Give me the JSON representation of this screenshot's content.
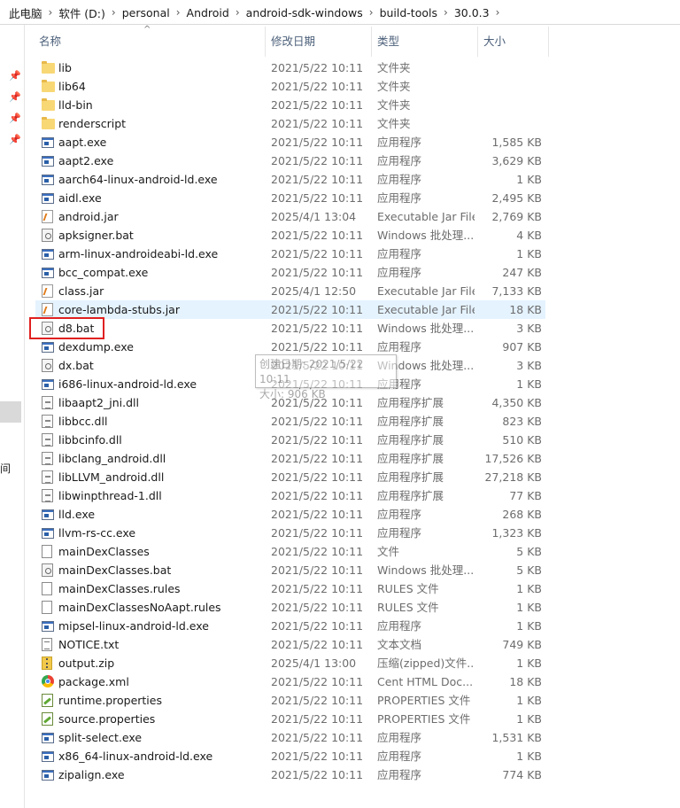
{
  "breadcrumb": [
    "此电脑",
    "软件 (D:)",
    "personal",
    "Android",
    "android-sdk-windows",
    "build-tools",
    "30.0.3"
  ],
  "left_nav": {
    "partial_label": "间"
  },
  "columns": {
    "name": "名称",
    "date": "修改日期",
    "type": "类型",
    "size": "大小"
  },
  "sort_indicator": "^",
  "tooltip": {
    "created": "创建日期: 2021/5/22 10:11",
    "size": "大小: 906 KB"
  },
  "files": [
    {
      "name": "lib",
      "date": "2021/5/22 10:11",
      "type": "文件夹",
      "size": "",
      "icon": "folder-icon"
    },
    {
      "name": "lib64",
      "date": "2021/5/22 10:11",
      "type": "文件夹",
      "size": "",
      "icon": "folder-icon"
    },
    {
      "name": "lld-bin",
      "date": "2021/5/22 10:11",
      "type": "文件夹",
      "size": "",
      "icon": "folder-icon"
    },
    {
      "name": "renderscript",
      "date": "2021/5/22 10:11",
      "type": "文件夹",
      "size": "",
      "icon": "folder-icon"
    },
    {
      "name": "aapt.exe",
      "date": "2021/5/22 10:11",
      "type": "应用程序",
      "size": "1,585 KB",
      "icon": "exe-icon"
    },
    {
      "name": "aapt2.exe",
      "date": "2021/5/22 10:11",
      "type": "应用程序",
      "size": "3,629 KB",
      "icon": "exe-icon"
    },
    {
      "name": "aarch64-linux-android-ld.exe",
      "date": "2021/5/22 10:11",
      "type": "应用程序",
      "size": "1 KB",
      "icon": "exe-icon"
    },
    {
      "name": "aidl.exe",
      "date": "2021/5/22 10:11",
      "type": "应用程序",
      "size": "2,495 KB",
      "icon": "exe-icon"
    },
    {
      "name": "android.jar",
      "date": "2025/4/1 13:04",
      "type": "Executable Jar File",
      "size": "2,769 KB",
      "icon": "jar-icon"
    },
    {
      "name": "apksigner.bat",
      "date": "2021/5/22 10:11",
      "type": "Windows 批处理...",
      "size": "4 KB",
      "icon": "bat-icon"
    },
    {
      "name": "arm-linux-androideabi-ld.exe",
      "date": "2021/5/22 10:11",
      "type": "应用程序",
      "size": "1 KB",
      "icon": "exe-icon"
    },
    {
      "name": "bcc_compat.exe",
      "date": "2021/5/22 10:11",
      "type": "应用程序",
      "size": "247 KB",
      "icon": "exe-icon"
    },
    {
      "name": "class.jar",
      "date": "2025/4/1 12:50",
      "type": "Executable Jar File",
      "size": "7,133 KB",
      "icon": "jar-icon"
    },
    {
      "name": "core-lambda-stubs.jar",
      "date": "2021/5/22 10:11",
      "type": "Executable Jar File",
      "size": "18 KB",
      "icon": "jar-icon",
      "hover": true
    },
    {
      "name": "d8.bat",
      "date": "2021/5/22 10:11",
      "type": "Windows 批处理...",
      "size": "3 KB",
      "icon": "bat-icon"
    },
    {
      "name": "dexdump.exe",
      "date": "2021/5/22 10:11",
      "type": "应用程序",
      "size": "907 KB",
      "icon": "exe-icon"
    },
    {
      "name": "dx.bat",
      "date": "2021/5/22 10:11",
      "type": "Windows 批处理...",
      "size": "3 KB",
      "icon": "bat-icon"
    },
    {
      "name": "i686-linux-android-ld.exe",
      "date": "2021/5/22 10:11",
      "type": "应用程序",
      "size": "1 KB",
      "icon": "exe-icon"
    },
    {
      "name": "libaapt2_jni.dll",
      "date": "2021/5/22 10:11",
      "type": "应用程序扩展",
      "size": "4,350 KB",
      "icon": "dll-icon"
    },
    {
      "name": "libbcc.dll",
      "date": "2021/5/22 10:11",
      "type": "应用程序扩展",
      "size": "823 KB",
      "icon": "dll-icon"
    },
    {
      "name": "libbcinfo.dll",
      "date": "2021/5/22 10:11",
      "type": "应用程序扩展",
      "size": "510 KB",
      "icon": "dll-icon"
    },
    {
      "name": "libclang_android.dll",
      "date": "2021/5/22 10:11",
      "type": "应用程序扩展",
      "size": "17,526 KB",
      "icon": "dll-icon"
    },
    {
      "name": "libLLVM_android.dll",
      "date": "2021/5/22 10:11",
      "type": "应用程序扩展",
      "size": "27,218 KB",
      "icon": "dll-icon"
    },
    {
      "name": "libwinpthread-1.dll",
      "date": "2021/5/22 10:11",
      "type": "应用程序扩展",
      "size": "77 KB",
      "icon": "dll-icon"
    },
    {
      "name": "lld.exe",
      "date": "2021/5/22 10:11",
      "type": "应用程序",
      "size": "268 KB",
      "icon": "exe-icon"
    },
    {
      "name": "llvm-rs-cc.exe",
      "date": "2021/5/22 10:11",
      "type": "应用程序",
      "size": "1,323 KB",
      "icon": "exe-icon"
    },
    {
      "name": "mainDexClasses",
      "date": "2021/5/22 10:11",
      "type": "文件",
      "size": "5 KB",
      "icon": "file-icon"
    },
    {
      "name": "mainDexClasses.bat",
      "date": "2021/5/22 10:11",
      "type": "Windows 批处理...",
      "size": "5 KB",
      "icon": "bat-icon"
    },
    {
      "name": "mainDexClasses.rules",
      "date": "2021/5/22 10:11",
      "type": "RULES 文件",
      "size": "1 KB",
      "icon": "file-icon"
    },
    {
      "name": "mainDexClassesNoAapt.rules",
      "date": "2021/5/22 10:11",
      "type": "RULES 文件",
      "size": "1 KB",
      "icon": "file-icon"
    },
    {
      "name": "mipsel-linux-android-ld.exe",
      "date": "2021/5/22 10:11",
      "type": "应用程序",
      "size": "1 KB",
      "icon": "exe-icon"
    },
    {
      "name": "NOTICE.txt",
      "date": "2021/5/22 10:11",
      "type": "文本文档",
      "size": "749 KB",
      "icon": "text-file-icon"
    },
    {
      "name": "output.zip",
      "date": "2025/4/1 13:00",
      "type": "压缩(zipped)文件...",
      "size": "1 KB",
      "icon": "zip-icon"
    },
    {
      "name": "package.xml",
      "date": "2021/5/22 10:11",
      "type": "Cent HTML Doc...",
      "size": "18 KB",
      "icon": "xml-browser-icon"
    },
    {
      "name": "runtime.properties",
      "date": "2021/5/22 10:11",
      "type": "PROPERTIES 文件",
      "size": "1 KB",
      "icon": "properties-icon"
    },
    {
      "name": "source.properties",
      "date": "2021/5/22 10:11",
      "type": "PROPERTIES 文件",
      "size": "1 KB",
      "icon": "properties-icon"
    },
    {
      "name": "split-select.exe",
      "date": "2021/5/22 10:11",
      "type": "应用程序",
      "size": "1,531 KB",
      "icon": "exe-icon"
    },
    {
      "name": "x86_64-linux-android-ld.exe",
      "date": "2021/5/22 10:11",
      "type": "应用程序",
      "size": "1 KB",
      "icon": "exe-icon"
    },
    {
      "name": "zipalign.exe",
      "date": "2021/5/22 10:11",
      "type": "应用程序",
      "size": "774 KB",
      "icon": "exe-icon"
    }
  ]
}
